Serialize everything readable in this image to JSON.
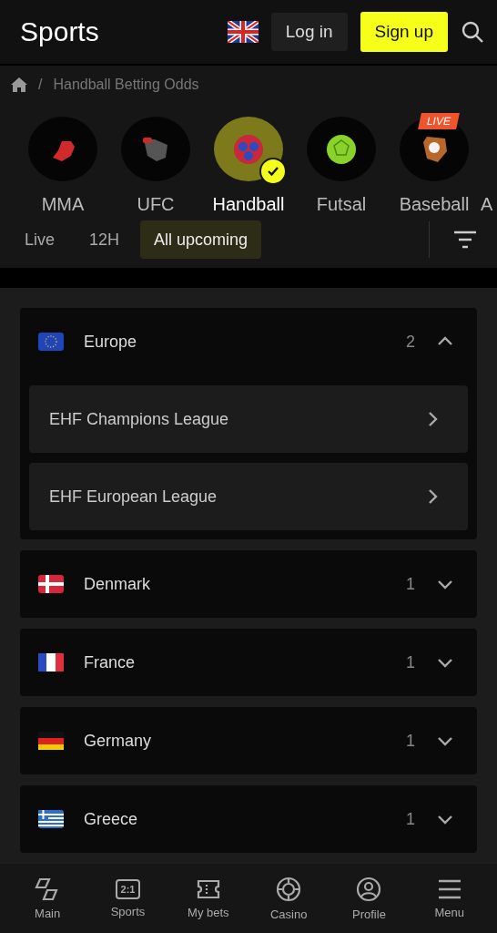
{
  "header": {
    "title": "Sports",
    "login": "Log in",
    "signup": "Sign up"
  },
  "breadcrumb": {
    "separator": "/",
    "current": "Handball Betting Odds"
  },
  "sports": [
    {
      "label": "MMA",
      "selected": false
    },
    {
      "label": "UFC",
      "selected": false
    },
    {
      "label": "Handball",
      "selected": true
    },
    {
      "label": "Futsal",
      "selected": false
    },
    {
      "label": "Baseball",
      "selected": false,
      "badge": "LIVE"
    },
    {
      "label": "A"
    }
  ],
  "filters": [
    {
      "label": "Live",
      "selected": false
    },
    {
      "label": "12H",
      "selected": false
    },
    {
      "label": "All upcoming",
      "selected": true
    }
  ],
  "regions": [
    {
      "name": "Europe",
      "count": "2",
      "expanded": true,
      "leagues": [
        "EHF Champions League",
        "EHF European League"
      ]
    },
    {
      "name": "Denmark",
      "count": "1",
      "expanded": false
    },
    {
      "name": "France",
      "count": "1",
      "expanded": false
    },
    {
      "name": "Germany",
      "count": "1",
      "expanded": false
    },
    {
      "name": "Greece",
      "count": "1",
      "expanded": false
    }
  ],
  "nav": [
    {
      "label": "Main",
      "selected": false
    },
    {
      "label": "Sports",
      "selected": false,
      "icon_text": "2:1"
    },
    {
      "label": "My bets",
      "selected": false
    },
    {
      "label": "Casino",
      "selected": false
    },
    {
      "label": "Profile",
      "selected": false
    },
    {
      "label": "Menu",
      "selected": false
    }
  ]
}
